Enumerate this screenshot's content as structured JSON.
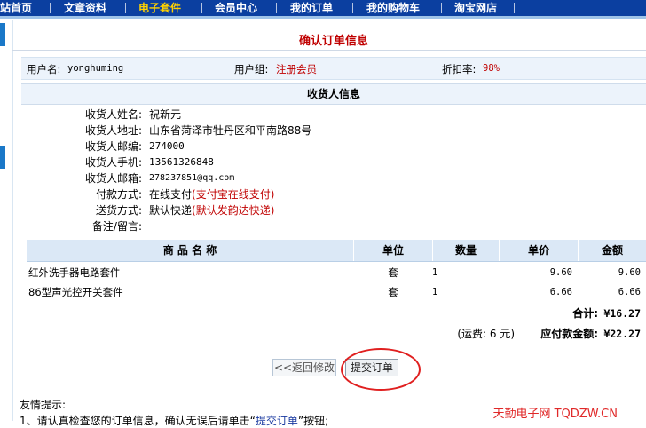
{
  "nav": {
    "items": [
      "站首页",
      "文章资料",
      "电子套件",
      "会员中心",
      "我的订单",
      "我的购物车",
      "淘宝网店"
    ],
    "active_index": 2
  },
  "page": {
    "title": "确认订单信息"
  },
  "user_info": {
    "username_label": "用户名:",
    "username": "yonghuming",
    "group_label": "用户组:",
    "group": "注册会员",
    "discount_label": "折扣率:",
    "discount": "98%"
  },
  "consignee": {
    "header": "收货人信息",
    "fields": [
      {
        "label": "收货人姓名:",
        "value": "祝新元",
        "note": ""
      },
      {
        "label": "收货人地址:",
        "value": "山东省菏泽市牡丹区和平南路88号",
        "note": ""
      },
      {
        "label": "收货人邮编:",
        "value": "274000",
        "note": ""
      },
      {
        "label": "收货人手机:",
        "value": "13561326848",
        "note": ""
      },
      {
        "label": "收货人邮箱:",
        "value": "278237851@qq.com",
        "note": ""
      },
      {
        "label": "付款方式:",
        "value": "在线支付",
        "note": "(支付宝在线支付)"
      },
      {
        "label": "送货方式:",
        "value": "默认快递",
        "note": "(默认发韵达快递)"
      },
      {
        "label": "备注/留言:",
        "value": "",
        "note": ""
      }
    ]
  },
  "items_table": {
    "headers": [
      "商 品 名 称",
      "单位",
      "数量",
      "单价",
      "金额"
    ],
    "rows": [
      [
        "红外洗手器电路套件",
        "套",
        "1",
        "9.60",
        "9.60"
      ],
      [
        "86型声光控开关套件",
        "套",
        "1",
        "6.66",
        "6.66"
      ]
    ]
  },
  "totals": {
    "total_label": "合计:",
    "total": "¥16.27",
    "shipping": "(运费: 6 元)",
    "payable_label": "应付款金额:",
    "payable": "¥22.27"
  },
  "buttons": {
    "back": "<<返回修改",
    "submit": "提交订单"
  },
  "hints": {
    "title": "友情提示:",
    "line1_a": "1、请认真检查您的订单信息，确认无误后请单击“",
    "line1_link": "提交订单",
    "line1_b": "”按钮;"
  },
  "watermark": "天勤电子网 TQDZW.CN"
}
